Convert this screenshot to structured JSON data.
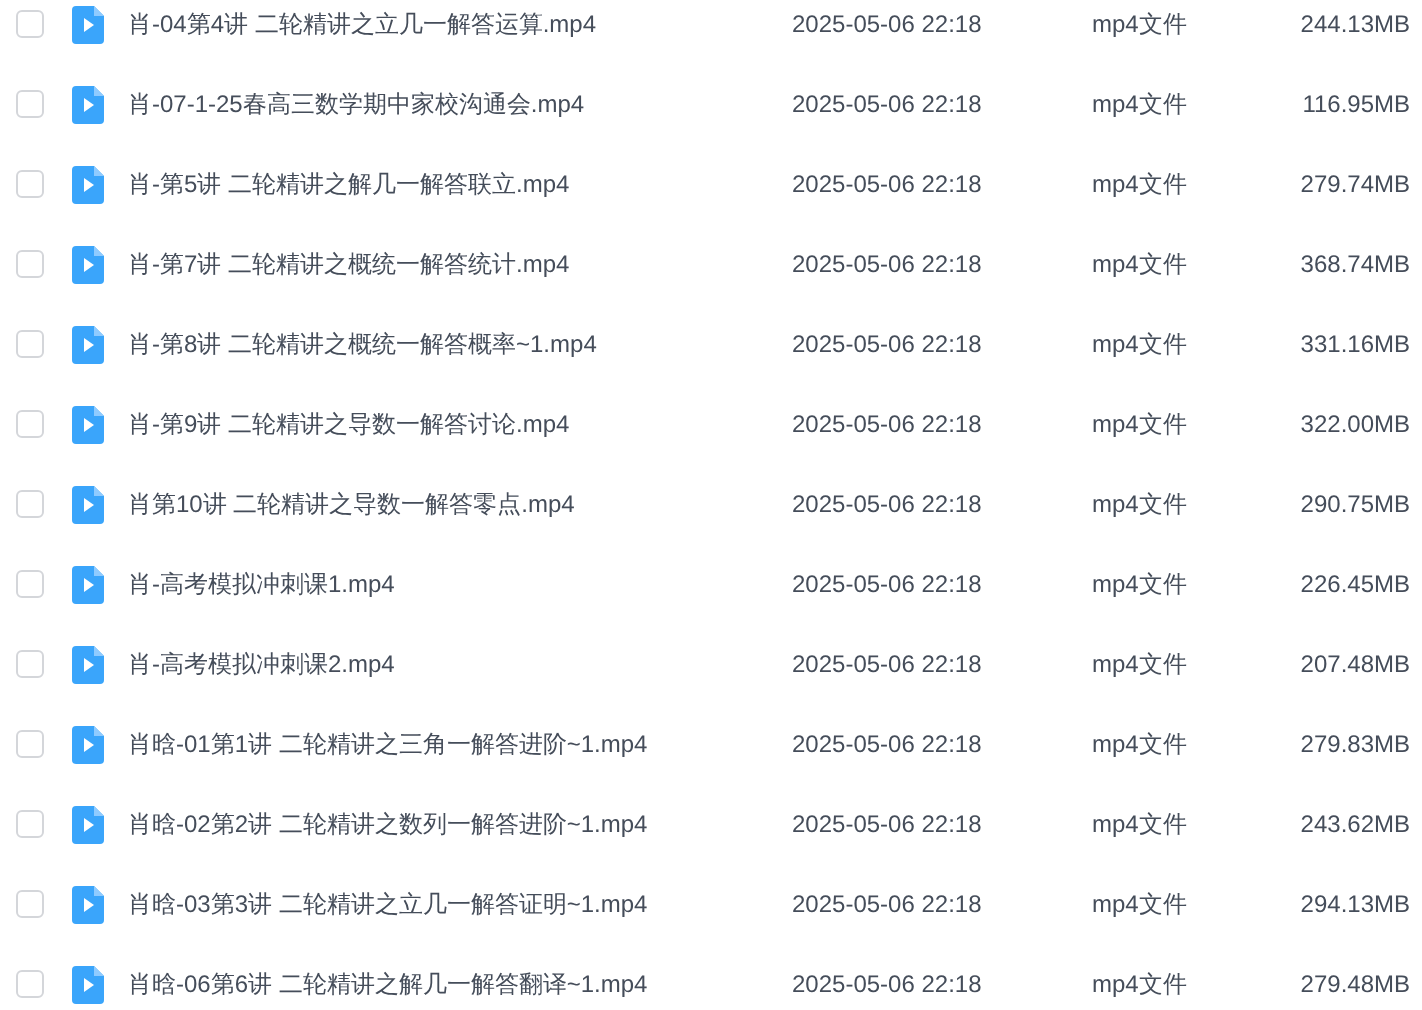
{
  "files": [
    {
      "name": "肖-04第4讲 二轮精讲之立几一解答运算.mp4",
      "modified": "2025-05-06 22:18",
      "type": "mp4文件",
      "size": "244.13MB",
      "checked": false
    },
    {
      "name": "肖-07-1-25春高三数学期中家校沟通会.mp4",
      "modified": "2025-05-06 22:18",
      "type": "mp4文件",
      "size": "116.95MB",
      "checked": false
    },
    {
      "name": "肖-第5讲 二轮精讲之解几一解答联立.mp4",
      "modified": "2025-05-06 22:18",
      "type": "mp4文件",
      "size": "279.74MB",
      "checked": false
    },
    {
      "name": "肖-第7讲 二轮精讲之概统一解答统计.mp4",
      "modified": "2025-05-06 22:18",
      "type": "mp4文件",
      "size": "368.74MB",
      "checked": false
    },
    {
      "name": "肖-第8讲 二轮精讲之概统一解答概率~1.mp4",
      "modified": "2025-05-06 22:18",
      "type": "mp4文件",
      "size": "331.16MB",
      "checked": false
    },
    {
      "name": "肖-第9讲 二轮精讲之导数一解答讨论.mp4",
      "modified": "2025-05-06 22:18",
      "type": "mp4文件",
      "size": "322.00MB",
      "checked": false
    },
    {
      "name": "肖第10讲 二轮精讲之导数一解答零点.mp4",
      "modified": "2025-05-06 22:18",
      "type": "mp4文件",
      "size": "290.75MB",
      "checked": false
    },
    {
      "name": "肖-高考模拟冲刺课1.mp4",
      "modified": "2025-05-06 22:18",
      "type": "mp4文件",
      "size": "226.45MB",
      "checked": false
    },
    {
      "name": "肖-高考模拟冲刺课2.mp4",
      "modified": "2025-05-06 22:18",
      "type": "mp4文件",
      "size": "207.48MB",
      "checked": false
    },
    {
      "name": "肖晗-01第1讲 二轮精讲之三角一解答进阶~1.mp4",
      "modified": "2025-05-06 22:18",
      "type": "mp4文件",
      "size": "279.83MB",
      "checked": false
    },
    {
      "name": "肖晗-02第2讲 二轮精讲之数列一解答进阶~1.mp4",
      "modified": "2025-05-06 22:18",
      "type": "mp4文件",
      "size": "243.62MB",
      "checked": false
    },
    {
      "name": "肖晗-03第3讲 二轮精讲之立几一解答证明~1.mp4",
      "modified": "2025-05-06 22:18",
      "type": "mp4文件",
      "size": "294.13MB",
      "checked": false
    },
    {
      "name": "肖晗-06第6讲 二轮精讲之解几一解答翻译~1.mp4",
      "modified": "2025-05-06 22:18",
      "type": "mp4文件",
      "size": "279.48MB",
      "checked": false
    }
  ]
}
